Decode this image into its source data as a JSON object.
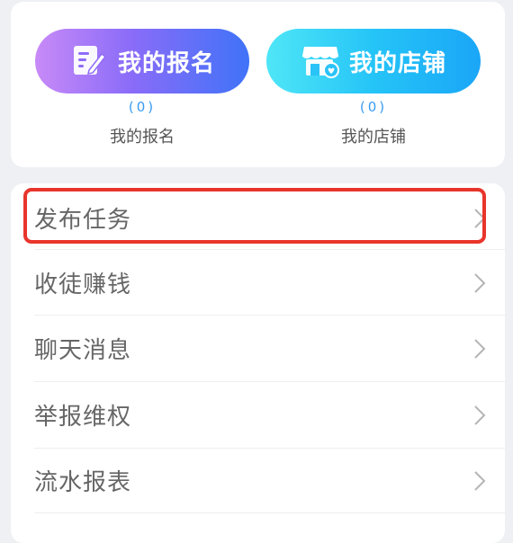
{
  "shortcuts": {
    "signup": {
      "label": "我的报名",
      "icon": "signup-form-icon",
      "count": "(0)",
      "caption": "我的报名"
    },
    "shop": {
      "label": "我的店铺",
      "icon": "shop-store-icon",
      "count": "(0)",
      "caption": "我的店铺"
    }
  },
  "menu": {
    "items": [
      {
        "label": "发布任务",
        "icon": "chevron-right-icon"
      },
      {
        "label": "收徒赚钱",
        "icon": "chevron-right-icon"
      },
      {
        "label": "聊天消息",
        "icon": "chevron-right-icon"
      },
      {
        "label": "举报维权",
        "icon": "chevron-right-icon"
      },
      {
        "label": "流水报表",
        "icon": "chevron-right-icon"
      }
    ]
  },
  "colors": {
    "highlight": "#e8352c",
    "count": "#3b9bf0"
  }
}
